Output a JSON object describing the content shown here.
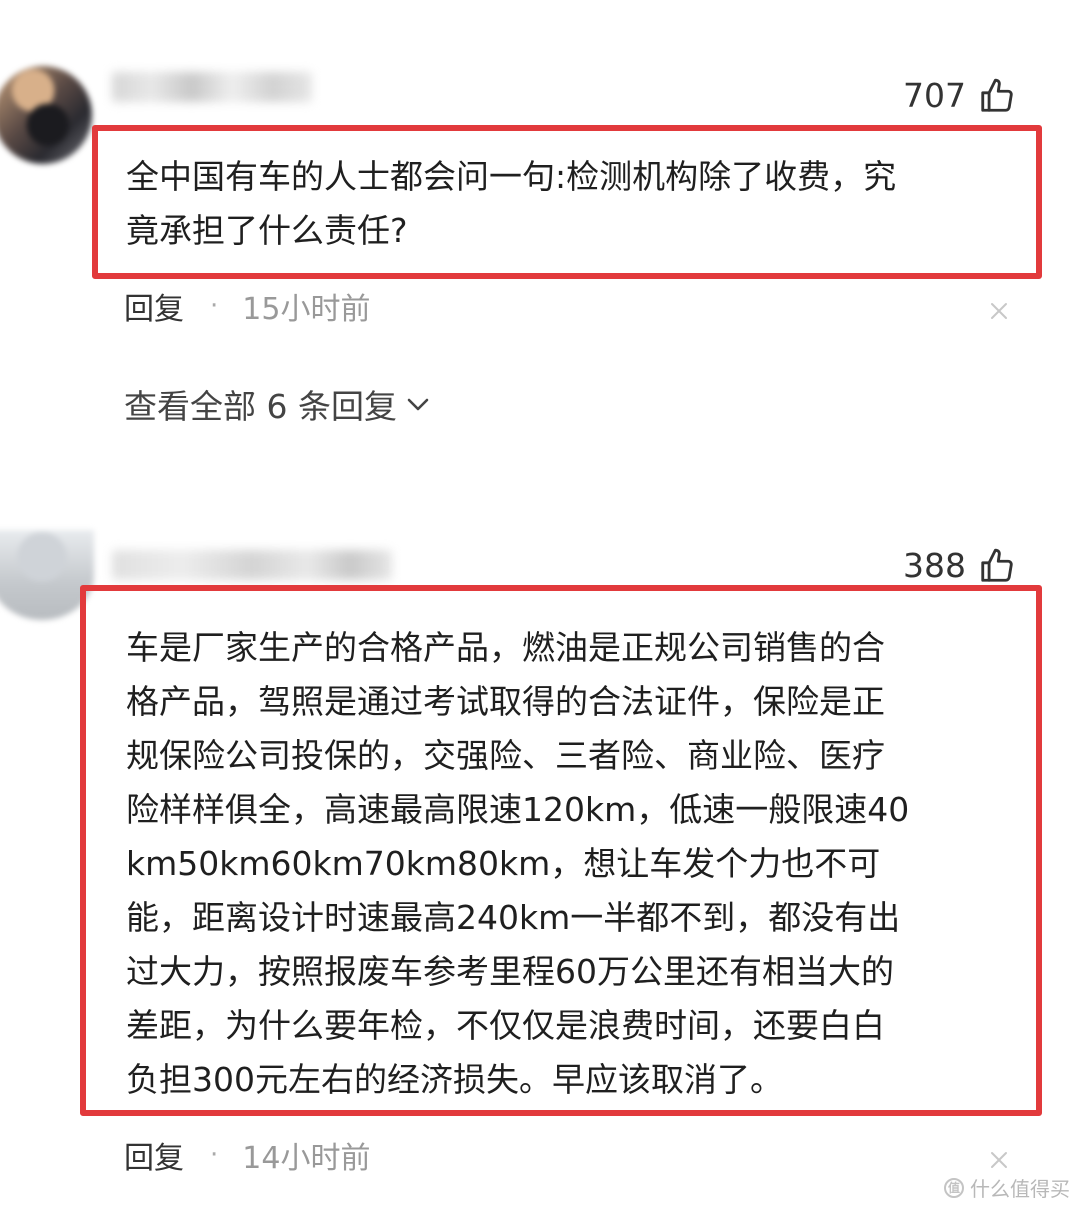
{
  "comments": [
    {
      "likes": "707",
      "text": "全中国有车的人士都会问一句:检测机构除了收费，究\n竟承担了什么责任?",
      "reply_label": "回复",
      "separator": "·",
      "time": "15小时前",
      "view_all_replies": "查看全部 6 条回复"
    },
    {
      "likes": "388",
      "text": "车是厂家生产的合格产品，燃油是正规公司销售的合\n格产品，驾照是通过考试取得的合法证件，保险是正\n规保险公司投保的，交强险、三者险、商业险、医疗\n险样样俱全，高速最高限速120km，低速一般限速40\nkm50km60km70km80km，想让车发个力也不可\n能，距离设计时速最高240km一半都不到，都没有出\n过大力，按照报废车参考里程60万公里还有相当大的\n差距，为什么要年检，不仅仅是浪费时间，还要白白\n负担300元左右的经济损失。早应该取消了。",
      "reply_label": "回复",
      "separator": "·",
      "time": "14小时前"
    }
  ],
  "watermark": {
    "badge": "值",
    "text": "什么值得买"
  },
  "colors": {
    "highlight_border": "#e23a3c",
    "muted_text": "#999999"
  }
}
